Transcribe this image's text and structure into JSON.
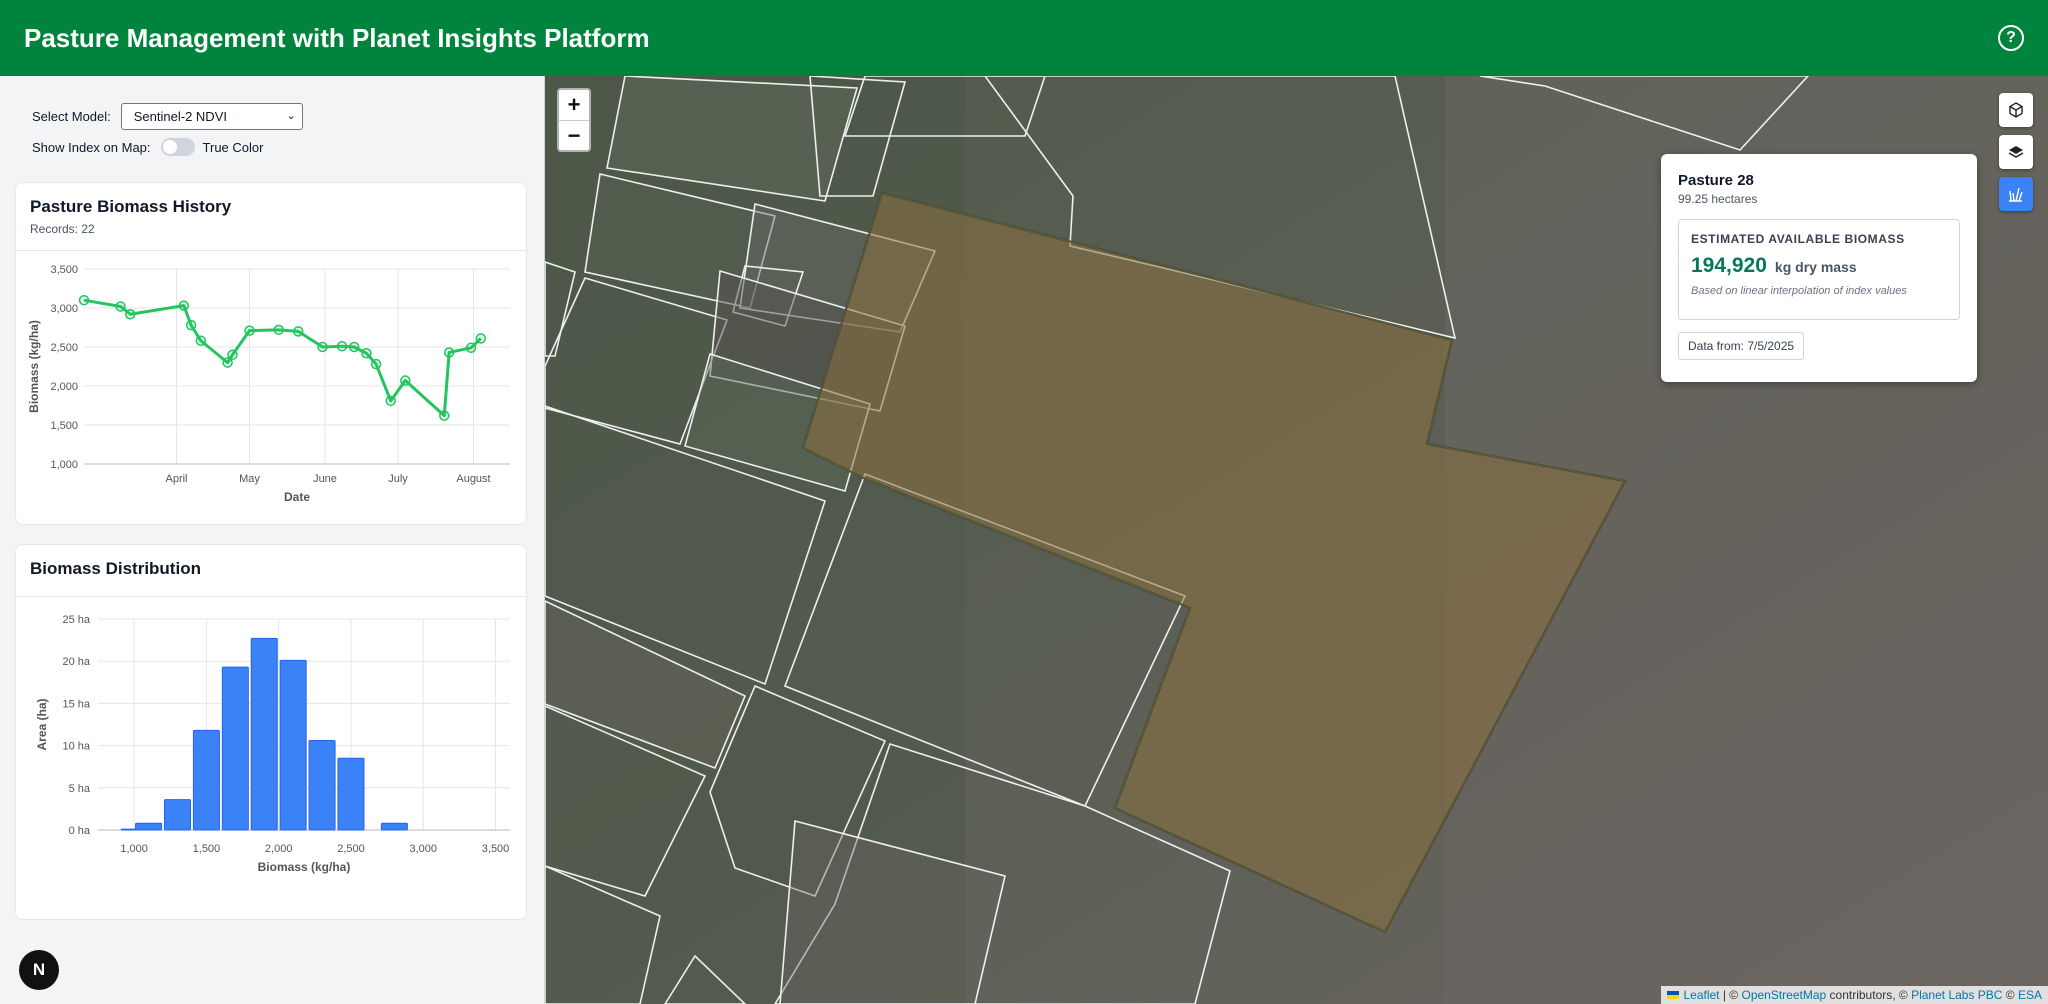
{
  "header": {
    "title": "Pasture Management with Planet Insights Platform",
    "help_icon": "question-circle-icon"
  },
  "controls": {
    "model_label": "Select Model:",
    "model_value": "Sentinel-2 NDVI",
    "index_label": "Show Index on Map:",
    "index_toggle_on": false,
    "index_toggle_label": "True Color"
  },
  "history": {
    "title": "Pasture Biomass History",
    "records": "Records: 22"
  },
  "distribution": {
    "title": "Biomass Distribution"
  },
  "chart_data": [
    {
      "type": "line",
      "title": "Pasture Biomass History",
      "xlabel": "Date",
      "ylabel": "Biomass (kg/ha)",
      "ylim": [
        1000,
        3500
      ],
      "y_ticks": [
        "1,000",
        "1,500",
        "2,000",
        "2,500",
        "3,000",
        "3,500"
      ],
      "x_ticks": [
        "April",
        "May",
        "June",
        "July",
        "August"
      ],
      "x_tick_days": [
        91,
        121,
        152,
        182,
        213
      ],
      "xlim_days": [
        53,
        228
      ],
      "color": "#22c55e",
      "grid": true,
      "series": [
        {
          "x_days": [
            53,
            68,
            72,
            94,
            97,
            101,
            112,
            114,
            121,
            133,
            141,
            151,
            159,
            164,
            169,
            173,
            179,
            185,
            201,
            203,
            212,
            216
          ],
          "values": [
            3100,
            3020,
            2920,
            3030,
            2780,
            2580,
            2300,
            2400,
            2710,
            2720,
            2700,
            2500,
            2510,
            2500,
            2420,
            2280,
            1810,
            2070,
            1620,
            2430,
            2490,
            2610
          ]
        }
      ]
    },
    {
      "type": "bar",
      "title": "Biomass Distribution",
      "xlabel": "Biomass (kg/ha)",
      "ylabel": "Area (ha)",
      "ylim": [
        0,
        25
      ],
      "y_ticks": [
        "0 ha",
        "5 ha",
        "10 ha",
        "15 ha",
        "20 ha",
        "25 ha"
      ],
      "x_ticks": [
        "1,000",
        "1,500",
        "2,000",
        "2,500",
        "3,000",
        "3,500"
      ],
      "x_tick_values": [
        1000,
        1500,
        2000,
        2500,
        3000,
        3500
      ],
      "xlim": [
        750,
        3600
      ],
      "color": "#3b82f6",
      "grid": true,
      "bin_centers": [
        1000,
        1100,
        1300,
        1500,
        1700,
        1900,
        2100,
        2300,
        2500,
        2800
      ],
      "values": [
        0.1,
        0.8,
        3.6,
        11.8,
        19.3,
        22.7,
        20.1,
        10.6,
        8.5,
        0.8
      ]
    }
  ],
  "map": {
    "zoom_in": "+",
    "zoom_out": "−",
    "tools": [
      "cube-icon",
      "layers-icon",
      "grass-icon"
    ],
    "active_tool": "grass-icon",
    "attribution": {
      "leaflet": "Leaflet",
      "sep1": " | © ",
      "osm": "OpenStreetMap",
      "sep2": " contributors, © ",
      "planet": "Planet Labs PBC",
      "sep3": " © ",
      "esa": "ESA"
    }
  },
  "popup": {
    "title": "Pasture 28",
    "area": "99.25 hectares",
    "biomass_label": "ESTIMATED AVAILABLE BIOMASS",
    "biomass_value": "194,920",
    "biomass_unit": "kg dry mass",
    "note": "Based on linear interpolation of index values",
    "date": "Data from: 7/5/2025"
  },
  "badge": {
    "letter": "N"
  }
}
